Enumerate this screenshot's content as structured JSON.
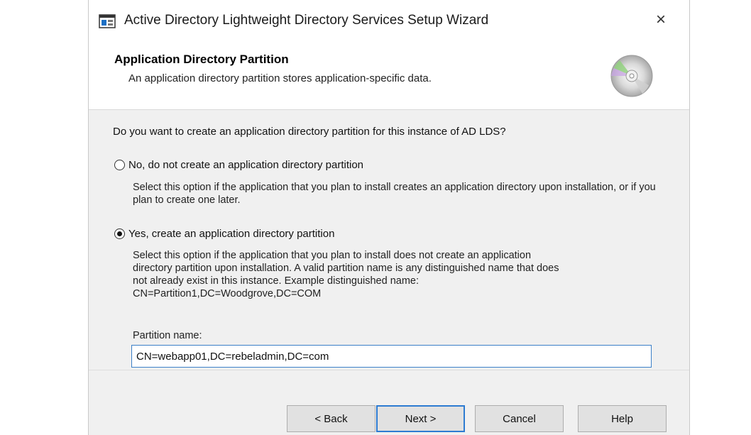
{
  "window": {
    "title": "Active Directory Lightweight Directory Services Setup Wizard",
    "close_glyph": "×",
    "app_icon": "wizard-app-icon"
  },
  "header": {
    "title": "Application Directory Partition",
    "subtitle": "An application directory partition stores application-specific data.",
    "icon": "cd-disc-icon"
  },
  "content": {
    "question": "Do you want to create an application directory partition for this instance of AD LDS?",
    "options": [
      {
        "label": "No, do not create an application directory partition",
        "selected": false,
        "description": "Select this option if the application that you plan to install creates an application directory upon installation, or if you plan to create one later."
      },
      {
        "label": "Yes, create an application directory partition",
        "selected": true,
        "description_lines": [
          "Select this option if the application that you plan to install does not create an application",
          "directory partition upon installation. A valid partition name is any distinguished name that does",
          "not already exist in this instance. Example distinguished name:",
          "CN=Partition1,DC=Woodgrove,DC=COM"
        ]
      }
    ],
    "partition_name_label": "Partition name:",
    "partition_name_value": "CN=webapp01,DC=rebeladmin,DC=com"
  },
  "buttons": {
    "back": "< Back",
    "next": "Next >",
    "cancel": "Cancel",
    "help": "Help"
  },
  "colors": {
    "accent": "#2d7bd1",
    "content_bg": "#f0f0f0"
  }
}
